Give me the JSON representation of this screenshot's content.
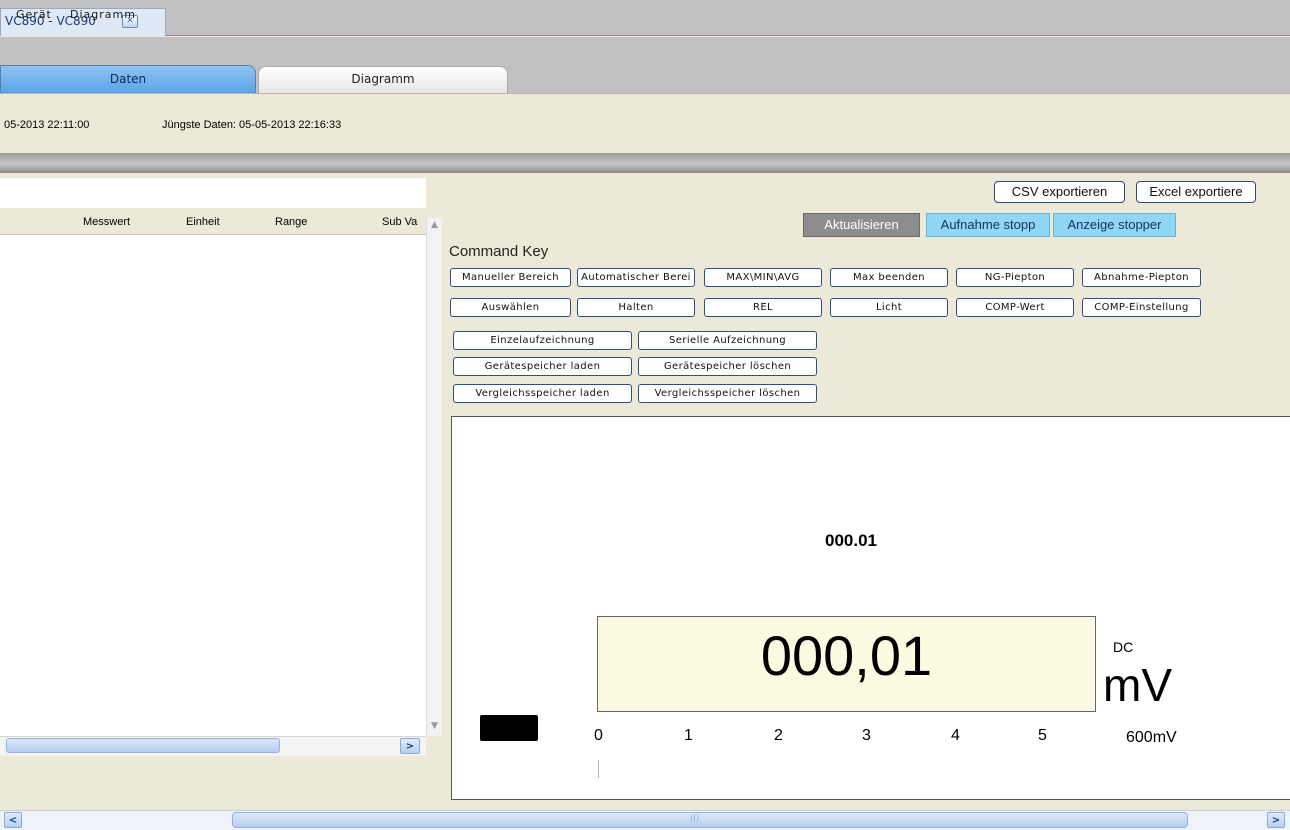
{
  "window": {
    "tab_title": "VC890 - VC890",
    "close_glyph": "✕"
  },
  "menu": {
    "items": [
      "Gerät",
      "Diagramm"
    ]
  },
  "tabs": [
    {
      "label": "Daten",
      "active": true
    },
    {
      "label": "Diagramm",
      "active": false
    }
  ],
  "info": {
    "first_date_partial": "05-2013 22:11:00",
    "latest_date": "Jüngste Daten: 05-05-2013 22:16:33"
  },
  "table": {
    "columns": [
      "Messwert",
      "Einheit",
      "Range",
      "Sub Va"
    ]
  },
  "toolbar": {
    "csv_export": "CSV exportieren",
    "excel_export": "Excel exportiere",
    "aktualisieren": "Aktualisieren",
    "aufnahme_stopp": "Aufnahme stopp",
    "anzeige_stopper": "Anzeige stopper"
  },
  "command_key": {
    "title": "Command Key",
    "row1": [
      "Manueller Bereich",
      "Automatischer Berei",
      "MAX\\MIN\\AVG",
      "Max beenden",
      "NG-Piepton",
      "Abnahme-Piepton"
    ],
    "row2": [
      "Auswählen",
      "Halten",
      "REL",
      "Licht",
      "COMP-Wert",
      "COMP-Einstellung"
    ],
    "row3": [
      "Einzelaufzeichnung",
      "Serielle Aufzeichnung"
    ],
    "row4": [
      "Gerätespeicher laden",
      "Gerätespeicher löschen"
    ],
    "row5": [
      "Vergleichsspeicher laden",
      "Vergleichsspeicher löschen"
    ]
  },
  "meter": {
    "reading_small": "000.01",
    "reading_large": "000,01",
    "mode": "DC",
    "unit": "mV",
    "scale_ticks": [
      "0",
      "1",
      "2",
      "3",
      "4",
      "5"
    ],
    "range_label": "600mV"
  },
  "colors": {
    "tab_active": "#5aa4e8",
    "button_highlight": "#8fd6f7",
    "button_grey": "#8d8d8d",
    "lcd_background": "#fcfbe2"
  }
}
